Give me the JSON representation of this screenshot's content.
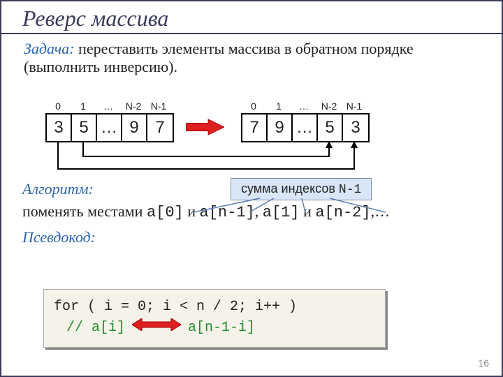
{
  "title": "Реверс массива",
  "task": {
    "label": "Задача:",
    "text": "переставить элементы массива в обратном порядке (выполнить инверсию)."
  },
  "indices": [
    "0",
    "1",
    "…",
    "N-2",
    "N-1"
  ],
  "arrayLeft": [
    "3",
    "5",
    "…",
    "9",
    "7"
  ],
  "arrayRight": [
    "7",
    "9",
    "…",
    "5",
    "3"
  ],
  "algo": {
    "label": "Алгоритм:",
    "text_pre": "поменять местами ",
    "code1": "a[0]",
    "mid1": " и ",
    "code2": "a[n-1]",
    "comma1": ", ",
    "code3": "a[1]",
    "mid2": " и ",
    "code4": "a[n-2]",
    "tail": ",…"
  },
  "callout": {
    "text": "сумма индексов ",
    "code": "N-1"
  },
  "pseudo": {
    "label": "Псевдокод:"
  },
  "code": {
    "line1": "for ( i = 0; i < n / 2; i++ )",
    "comment_left": "// a[i]",
    "comment_right": "a[n-1-i]"
  },
  "page": "16"
}
